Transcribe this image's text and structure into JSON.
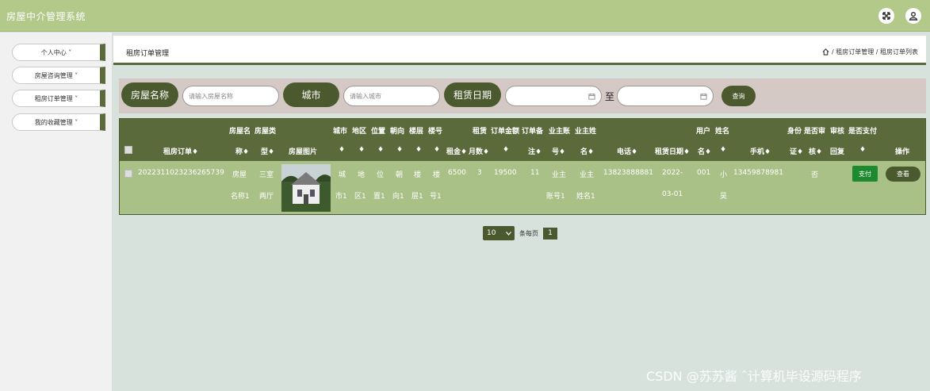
{
  "app": {
    "title": "房屋中介管理系统"
  },
  "topbar": {
    "fullscreen_icon": "fullscreen-icon",
    "user_icon": "user-icon"
  },
  "sidebar": {
    "items": [
      {
        "label": "个人中心 ˅"
      },
      {
        "label": "房屋咨询管理 ˅"
      },
      {
        "label": "租房订单管理 ˅"
      },
      {
        "label": "我的收藏管理 ˅"
      }
    ]
  },
  "header": {
    "title": "租房订单管理",
    "breadcrumb": "/ 租房订单管理 / 租房订单列表"
  },
  "search": {
    "house_name_label": "房屋名称",
    "house_name_placeholder": "请输入房屋名称",
    "city_label": "城市",
    "city_placeholder": "请输入城市",
    "rent_date_label": "租赁日期",
    "to_label": "至",
    "query_button": "查询"
  },
  "table": {
    "headers": {
      "order_no": "租房订单♦",
      "house_name_1": "房屋名",
      "house_name_2": "称♦",
      "house_type_1": "房屋类",
      "house_type_2": "型♦",
      "house_img": "房屋图片",
      "city_1": "城市",
      "city_2": "♦",
      "district_1": "地区",
      "district_2": "♦",
      "location_1": "位置",
      "location_2": "♦",
      "orientation_1": "朝向",
      "orientation_2": "♦",
      "floor_1": "楼层",
      "floor_2": "♦",
      "building_1": "楼号",
      "building_2": "♦",
      "rent": "租金♦",
      "months": "月数♦",
      "amount_1": "租赁",
      "amount_2": "订单金额",
      "amount_3": "♦",
      "remark_1": "订单备",
      "remark_2": "注♦",
      "owner_acct_1": "业主账",
      "owner_acct_2": "号♦",
      "owner_name_1": "业主姓",
      "owner_name_2": "名♦",
      "phone": "电话♦",
      "rent_date": "租赁日期♦",
      "username_1": "用户",
      "username_2": "名♦",
      "fullname_1": "姓名",
      "fullname_2": "♦",
      "mobile": "手机♦",
      "id_card_1": "身份",
      "id_card_2": "证♦",
      "audit_1": "是否审",
      "audit_2": "核♦",
      "reply_1": "审核",
      "reply_2": "回复",
      "paid_1": "是否支付",
      "paid_2": "♦",
      "actions": "操作"
    },
    "rows": [
      {
        "order_no": "2022311023236265739",
        "house_name_1": "房屋",
        "house_name_2": "名称1",
        "house_type_1": "三室",
        "house_type_2": "两厅",
        "city_1": "城",
        "city_2": "市1",
        "district_1": "地",
        "district_2": "区1",
        "location_1": "位",
        "location_2": "置1",
        "orientation_1": "朝",
        "orientation_2": "向1",
        "floor_1": "楼",
        "floor_2": "层1",
        "building_1": "楼",
        "building_2": "号1",
        "rent": "6500",
        "months": "3",
        "amount": "19500",
        "remark": "11",
        "owner_acct_1": "业主",
        "owner_acct_2": "账号1",
        "owner_name_1": "业主",
        "owner_name_2": "姓名1",
        "phone": "13823888881",
        "rent_date_1": "2022-",
        "rent_date_2": "03-01",
        "username": "001",
        "fullname_1": "小",
        "fullname_2": "吴",
        "mobile": "13459878981",
        "audit": "否",
        "pay_button": "支付",
        "view_button": "查看"
      }
    ]
  },
  "pagination": {
    "page_size": "10",
    "per_page_label": "条每页",
    "current_page": "1"
  },
  "watermark": "CSDN @苏苏酱   ˆ计算机毕设源码程序"
}
